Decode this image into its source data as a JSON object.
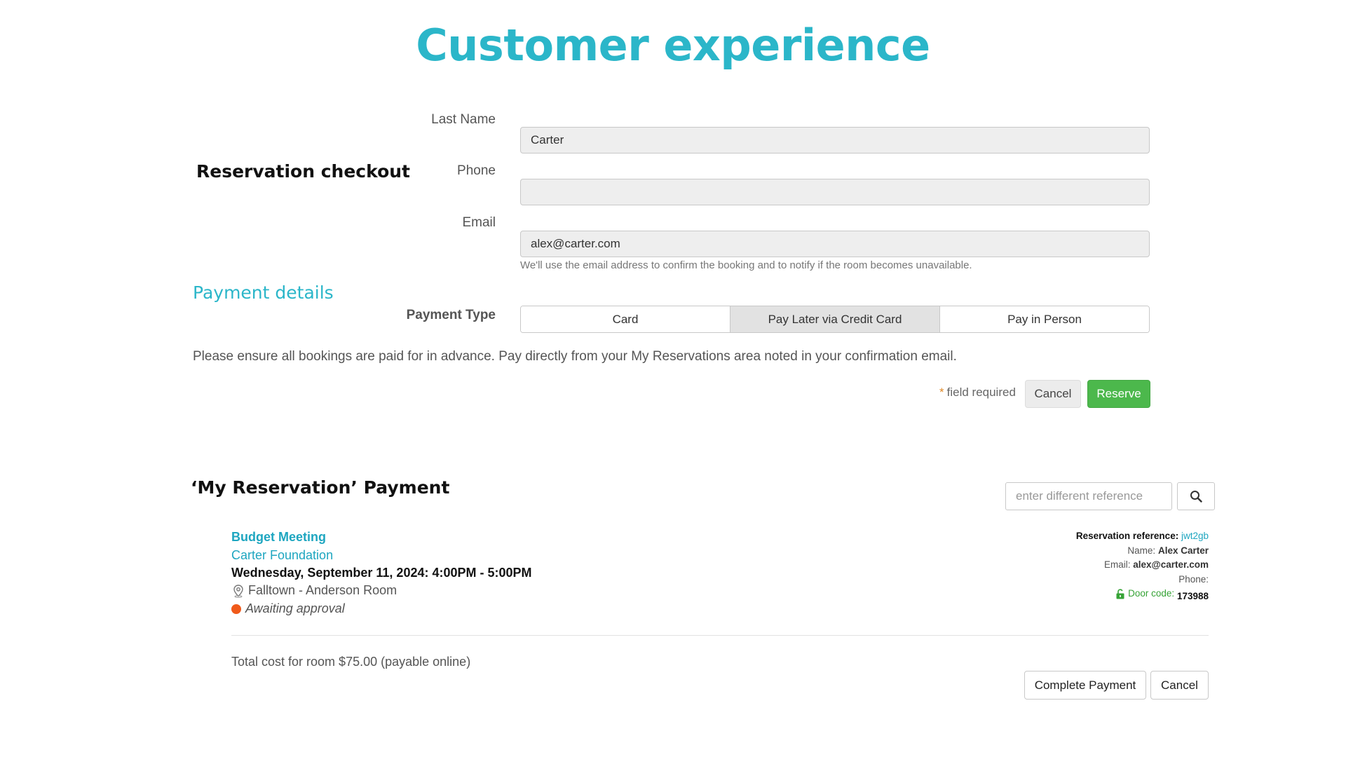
{
  "page": {
    "title": "Customer experience"
  },
  "checkout": {
    "heading": "Reservation checkout",
    "fields": {
      "last_name": {
        "label": "Last Name",
        "value": "Carter"
      },
      "phone": {
        "label": "Phone",
        "value": ""
      },
      "email": {
        "label": "Email",
        "value": "alex@carter.com",
        "help": "We'll use the email address to confirm the booking and to notify if the room becomes unavailable."
      }
    }
  },
  "payment": {
    "heading": "Payment details",
    "type_label": "Payment Type",
    "options": [
      "Card",
      "Pay Later via Credit Card",
      "Pay in Person"
    ],
    "selected": "Pay Later via Credit Card",
    "notice": "Please ensure all bookings are paid for in advance. Pay directly from your My Reservations area noted in your confirmation email.",
    "required_star": "*",
    "required_note": "field required",
    "cancel_label": "Cancel",
    "reserve_label": "Reserve"
  },
  "my_reservation": {
    "heading": "‘My Reservation’ Payment",
    "search": {
      "placeholder": "enter different reference",
      "value": ""
    },
    "event": {
      "title": "Budget Meeting",
      "organization": "Carter Foundation",
      "date_time": "Wednesday, September 11, 2024: 4:00PM - 5:00PM",
      "location": "Falltown - Anderson Room",
      "status": "Awaiting approval"
    },
    "details": {
      "reference_label": "Reservation reference:",
      "reference_value": "jwt2gb",
      "name_label": "Name:",
      "name_value": "Alex Carter",
      "email_label": "Email:",
      "email_value": "alex@carter.com",
      "phone_label": "Phone:",
      "phone_value": "",
      "door_label": "Door code:",
      "door_value": "173988"
    },
    "total_cost": "Total cost for room $75.00 (payable online)",
    "complete_label": "Complete Payment",
    "cancel_label": "Cancel"
  },
  "colors": {
    "accent": "#2bb6c9",
    "link": "#1ea6c0",
    "reserve_green": "#4cb84c",
    "status_orange": "#f05a1a",
    "door_green": "#36a336"
  },
  "icons": {
    "search": "search-icon",
    "location": "map-pin-icon",
    "status": "status-dot",
    "door": "unlock-icon"
  }
}
